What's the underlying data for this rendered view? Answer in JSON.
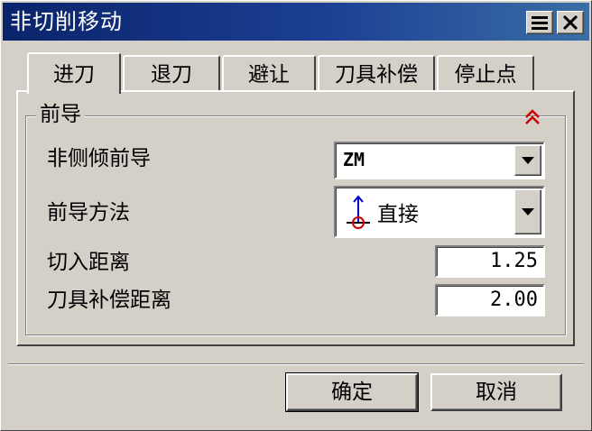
{
  "window": {
    "title": "非切削移动"
  },
  "tabs": [
    {
      "label": "进刀",
      "active": true
    },
    {
      "label": "退刀",
      "active": false
    },
    {
      "label": "避让",
      "active": false
    },
    {
      "label": "刀具补偿",
      "active": false
    },
    {
      "label": "停止点",
      "active": false
    }
  ],
  "group": {
    "label": "前导",
    "fields": {
      "non_side_lead": {
        "label": "非侧倾前导",
        "value": "ZM"
      },
      "lead_method": {
        "label": "前导方法",
        "value": "直接",
        "icon": "direct-lead-icon"
      },
      "cut_in_distance": {
        "label": "切入距离",
        "value": "1.25"
      },
      "tool_comp_distance": {
        "label": "刀具补偿距离",
        "value": "2.00"
      }
    }
  },
  "buttons": {
    "ok": "确定",
    "cancel": "取消"
  },
  "colors": {
    "titlebar": "#0a246a",
    "face": "#d4d0c8",
    "collapse_arrow": "#cc0000",
    "icon_blue": "#0000cc",
    "icon_red": "#cc0000"
  }
}
